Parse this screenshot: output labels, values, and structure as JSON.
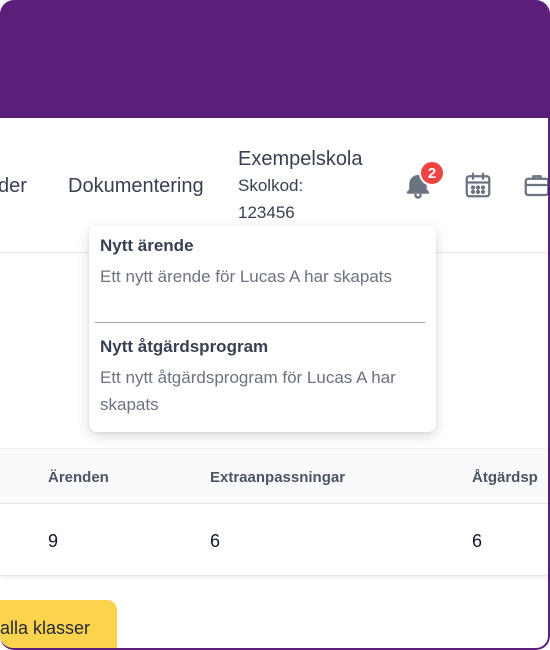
{
  "nav": {
    "partial_item": "der",
    "documentation": "Dokumentering",
    "school_name": "Exempelskola",
    "school_code_label": "Skolkod:",
    "school_code": "123456",
    "notification_count": "2"
  },
  "notifications": [
    {
      "title": "Nytt ärende",
      "text": "Ett nytt ärende för Lucas A har skapats"
    },
    {
      "title": "Nytt åtgärdsprogram",
      "text": "Ett nytt åtgärdsprogram för Lucas A har skapats"
    }
  ],
  "table": {
    "headers": [
      "Ärenden",
      "Extraanpassningar",
      "Åtgärdsp"
    ],
    "row": [
      "9",
      "6",
      "6"
    ]
  },
  "footer": {
    "all_classes_label": "alla klasser"
  },
  "colors": {
    "brand": "#5b1f7a",
    "badge": "#ef4444",
    "button": "#fcd34d"
  }
}
